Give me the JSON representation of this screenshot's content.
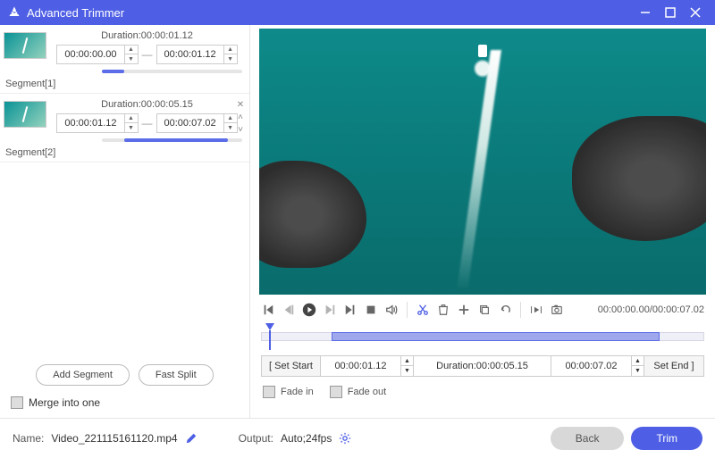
{
  "window": {
    "title": "Advanced Trimmer"
  },
  "segments": [
    {
      "label": "Segment[1]",
      "duration_label": "Duration:00:00:01.12",
      "start": "00:00:00.00",
      "end": "00:00:01.12",
      "bar_left_pct": 0,
      "bar_width_pct": 16,
      "has_controls": false
    },
    {
      "label": "Segment[2]",
      "duration_label": "Duration:00:00:05.15",
      "start": "00:00:01.12",
      "end": "00:00:07.02",
      "bar_left_pct": 16,
      "bar_width_pct": 74,
      "has_controls": true
    }
  ],
  "left_actions": {
    "add_segment": "Add Segment",
    "fast_split": "Fast Split",
    "merge_label": "Merge into one"
  },
  "player": {
    "time_display": "00:00:00.00/00:00:07.02",
    "timeline_sel_left_pct": 16,
    "timeline_sel_width_pct": 74,
    "playhead_pct": 1
  },
  "set_row": {
    "set_start": "[  Set Start",
    "start_val": "00:00:01.12",
    "duration": "Duration:00:00:05.15",
    "end_val": "00:00:07.02",
    "set_end": "Set End  ]"
  },
  "fade": {
    "in": "Fade in",
    "out": "Fade out"
  },
  "footer": {
    "name_label": "Name:",
    "filename": "Video_221115161120.mp4",
    "output_label": "Output:",
    "output_value": "Auto;24fps",
    "back": "Back",
    "trim": "Trim"
  }
}
